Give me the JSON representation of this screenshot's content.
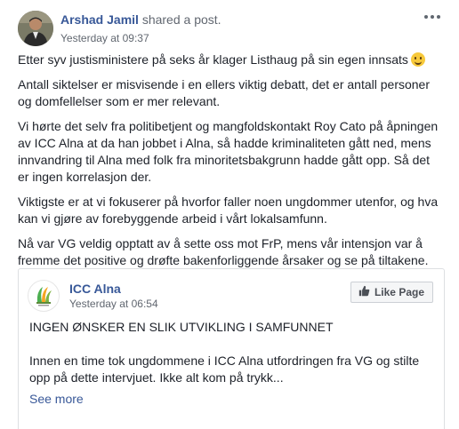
{
  "post": {
    "author": "Arshad Jamil",
    "action": " shared a post.",
    "time": "Yesterday at 09:37",
    "paragraphs": [
      "Etter syv justisministere på seks år klager Listhaug på sin egen innsats",
      "Antall siktelser er misvisende i en ellers viktig debatt, det er antall personer og domfellelser som er mer relevant.",
      "Vi hørte det selv fra politibetjent og mangfoldskontakt Roy Cato på åpningen av ICC Alna at da han jobbet i Alna, så hadde kriminaliteten gått ned, mens innvandring til Alna med folk fra minoritetsbakgrunn hadde gått opp. Så det er ingen korrelasjon der.",
      "Viktigste er at vi fokuserer på hvorfor faller noen ungdommer utenfor, og hva kan vi gjøre av forebyggende arbeid i vårt lokalsamfunn.",
      "Nå var VG veldig opptatt av å sette oss mot FrP, mens vår intensjon var å fremme det positive og drøfte bakenforliggende årsaker og se på tiltakene."
    ]
  },
  "shared": {
    "page_name": "ICC Alna",
    "time": "Yesterday at 06:54",
    "like_label": "Like Page",
    "paragraphs": [
      "INGEN ØNSKER EN SLIK UTVIKLING I SAMFUNNET",
      "Innen en time tok ungdommene i ICC Alna utfordringen fra VG og stilte opp på dette intervjuet. Ikke alt kom på trykk..."
    ],
    "see_more": "See more"
  },
  "icons": {
    "more": "more-options-icon",
    "emoji": "smiley-emoji-icon",
    "like": "thumbs-up-icon",
    "logo": "icc-alna-logo"
  },
  "colors": {
    "link": "#385898",
    "text": "#1d2129",
    "meta": "#616770"
  }
}
